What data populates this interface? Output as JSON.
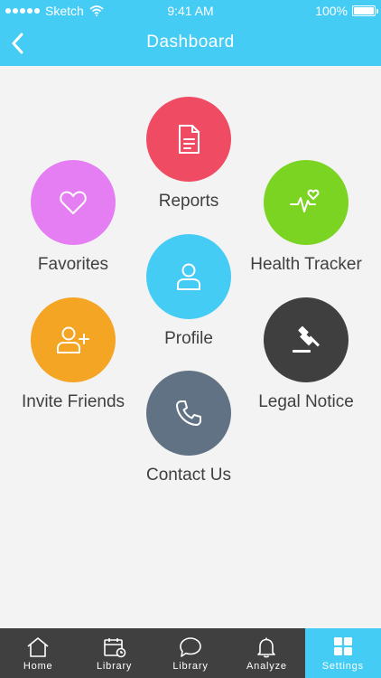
{
  "status_bar": {
    "carrier": "Sketch",
    "time": "9:41 AM",
    "battery": "100%"
  },
  "header": {
    "title": "Dashboard"
  },
  "colors": {
    "header": "#45ccf5",
    "reports": "#ef4b63",
    "favorites": "#e57ef2",
    "health_tracker": "#7bd322",
    "profile": "#45ccf5",
    "invite_friends": "#f4a524",
    "legal_notice": "#3f3f3f",
    "contact_us": "#617285",
    "tabbar": "#404040"
  },
  "menu": {
    "reports": {
      "label": "Reports",
      "icon": "document-icon"
    },
    "favorites": {
      "label": "Favorites",
      "icon": "heart-icon"
    },
    "health_tracker": {
      "label": "Health Tracker",
      "icon": "heart-pulse-icon"
    },
    "profile": {
      "label": "Profile",
      "icon": "user-icon"
    },
    "invite_friends": {
      "label": "Invite Friends",
      "icon": "add-user-icon"
    },
    "legal_notice": {
      "label": "Legal Notice",
      "icon": "gavel-icon"
    },
    "contact_us": {
      "label": "Contact Us",
      "icon": "phone-icon"
    }
  },
  "tabs": [
    {
      "label": "Home",
      "icon": "home-icon"
    },
    {
      "label": "Library",
      "icon": "calendar-clock-icon"
    },
    {
      "label": "Library",
      "icon": "chat-bubble-icon"
    },
    {
      "label": "Analyze",
      "icon": "bell-icon"
    },
    {
      "label": "Settings",
      "icon": "grid-icon",
      "active": true
    }
  ]
}
